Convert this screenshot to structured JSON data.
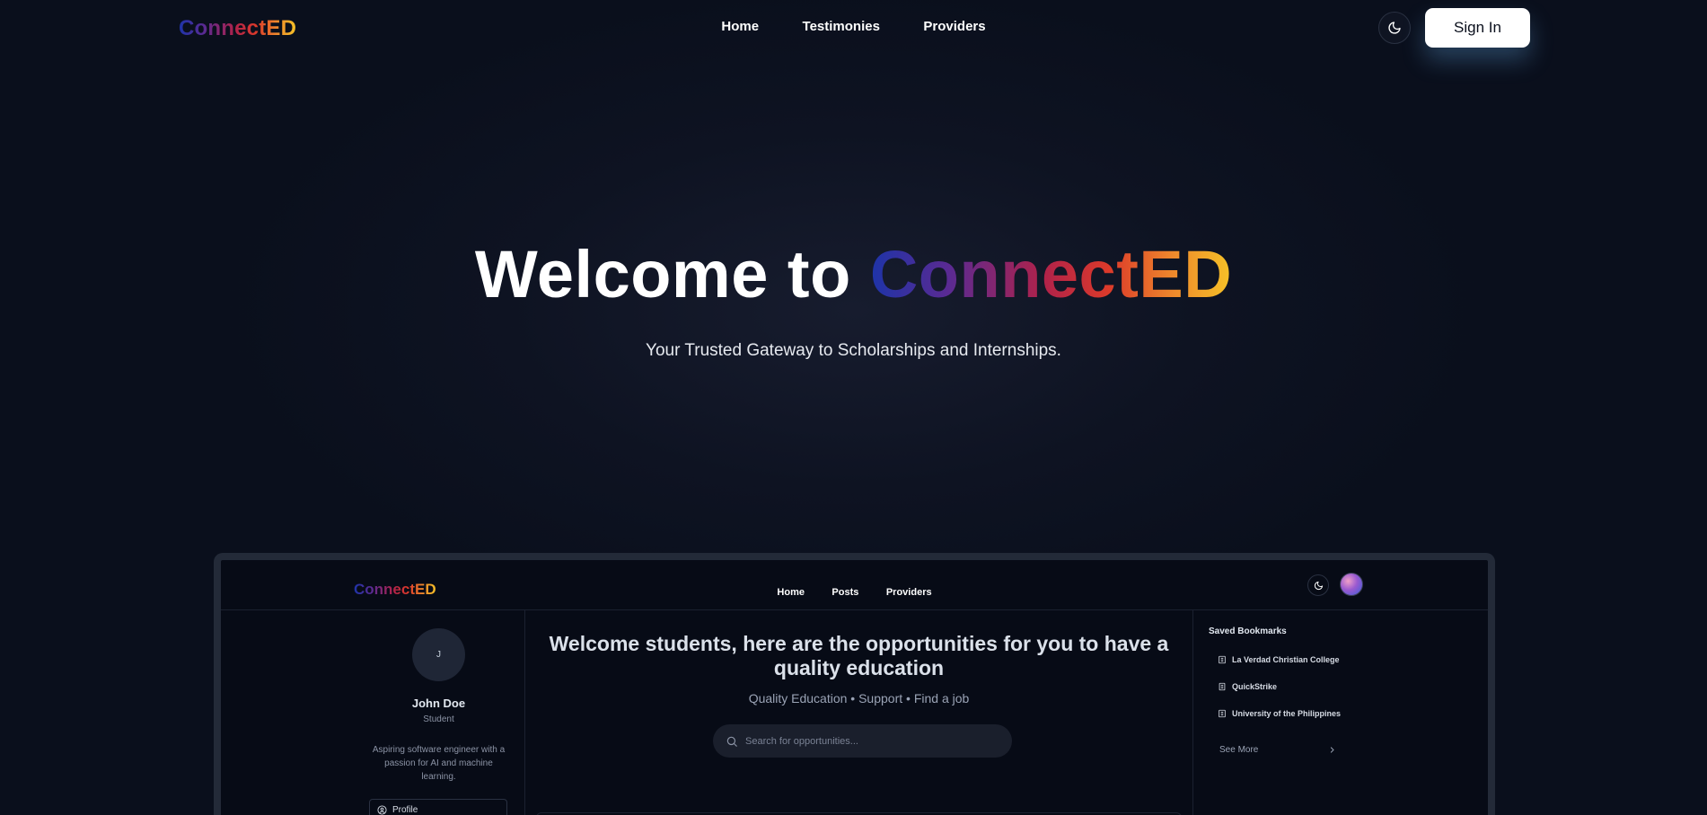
{
  "nav": {
    "logo": "ConnectED",
    "links": [
      "Home",
      "Testimonies",
      "Providers"
    ],
    "theme_icon": "moon-icon",
    "signin_label": "Sign In"
  },
  "hero": {
    "title_prefix": "Welcome to ",
    "title_brand": "ConnectED",
    "subtitle": "Your Trusted Gateway to Scholarships and Internships."
  },
  "preview": {
    "nav": {
      "logo": "ConnectED",
      "links": [
        "Home",
        "Posts",
        "Providers"
      ]
    },
    "profile": {
      "initial": "J",
      "name": "John Doe",
      "role": "Student",
      "bio": "Aspiring software engineer with a passion for AI and machine learning.",
      "button_label": "Profile"
    },
    "main": {
      "title": "Welcome students, here are the opportunities for you to have a quality education",
      "subtitle": "Quality Education • Support • Find a job",
      "search_placeholder": "Search for opportunities..."
    },
    "bookmarks": {
      "title": "Saved Bookmarks",
      "items": [
        "La Verdad Christian College",
        "QuickStrike",
        "University of the Philippines"
      ],
      "see_more": "See More"
    }
  },
  "colors": {
    "background": "#0a0f1c",
    "brand_gradient": [
      "#1d34a8",
      "#5b2a92",
      "#b0224a",
      "#dc3a2a",
      "#ef8a2c",
      "#f5c227"
    ],
    "button_bg": "#ffffff"
  }
}
